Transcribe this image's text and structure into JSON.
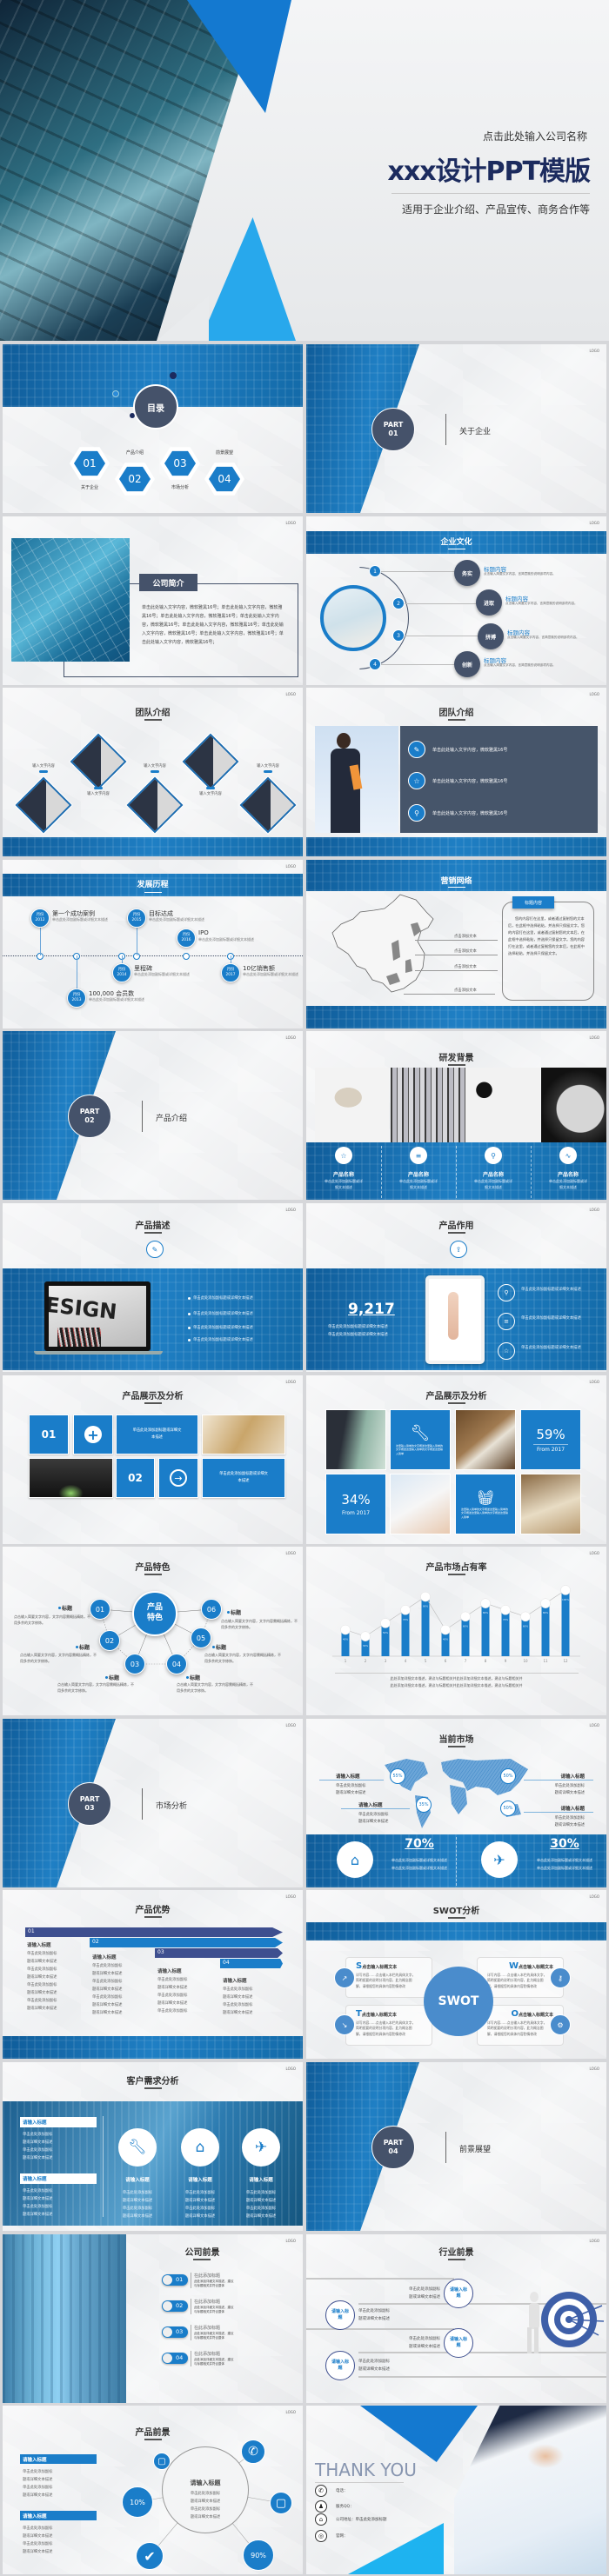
{
  "hero": {
    "company": "点击此处输入公司名称",
    "title": "xxx设计PPT模版",
    "subtitle": "适用于企业介绍、产品宣传、商务合作等"
  },
  "logo": "LOGO",
  "toc": {
    "title": "目录",
    "items": [
      {
        "num": "01",
        "label": "关于企业"
      },
      {
        "num": "02",
        "label": "产品介绍"
      },
      {
        "num": "03",
        "label": "市场分析"
      },
      {
        "num": "04",
        "label": "前景展望"
      }
    ]
  },
  "parts": [
    {
      "label": "PART",
      "num": "01",
      "name": "关于企业"
    },
    {
      "label": "PART",
      "num": "02",
      "name": "产品介绍"
    },
    {
      "label": "PART",
      "num": "03",
      "name": "市场分析"
    },
    {
      "label": "PART",
      "num": "04",
      "name": "前景展望"
    }
  ],
  "about": {
    "title": "公司简介",
    "body": "单击此处输入文字内容，微软雅黑16号；单击此处输入文字内容，微软雅黑16号；单击此处输入文字内容，微软雅黑16号；单击此处输入文字内容，微软雅黑16号；单击此处输入文字内容，微软雅黑16号；单击此处输入文字内容，微软雅黑16号；单击此处输入文字内容，微软雅黑16号；单击此处输入文字内容，微软雅黑16号；"
  },
  "culture": {
    "title": "企业文化",
    "items": [
      {
        "n": "1",
        "tag": "务实",
        "title": "标题内容",
        "desc": "点击输入简要文字内容，言简意赅的说明该项内容。"
      },
      {
        "n": "2",
        "tag": "进取",
        "title": "标题内容",
        "desc": "点击输入简要文字内容，言简意赅的说明该项内容。"
      },
      {
        "n": "3",
        "tag": "拼搏",
        "title": "标题内容",
        "desc": "点击输入简要文字内容，言简意赅的说明该项内容。"
      },
      {
        "n": "4",
        "tag": "创新",
        "title": "标题内容",
        "desc": "点击输入简要文字内容，言简意赅的说明该项内容。"
      }
    ]
  },
  "team1": {
    "title": "团队介绍",
    "captions": [
      "输入文字内容",
      "输入文字内容",
      "输入文字内容",
      "输入文字内容",
      "输入文字内容"
    ]
  },
  "team2": {
    "title": "团队介绍",
    "items": [
      {
        "icon": "edit-icon",
        "text": "单击此处输入文字内容，微软雅黑16号"
      },
      {
        "icon": "star-icon",
        "text": "单击此处输入文字内容，微软雅黑16号"
      },
      {
        "icon": "bulb-icon",
        "text": "单击此处输入文字内容，微软雅黑16号"
      }
    ]
  },
  "history": {
    "title": "发展历程",
    "month": "月份",
    "items": [
      {
        "year": "2012",
        "title": "第一个成功案例",
        "desc": "单击此处添加副标题或详细文本描述"
      },
      {
        "year": "2013",
        "title": "100,000 会员数",
        "desc": "单击此处添加副标题或详细文本描述"
      },
      {
        "year": "2014",
        "title": "里程碑",
        "desc": "单击此处添加副标题或详细文本描述"
      },
      {
        "year": "2015",
        "title": "目标达成",
        "desc": "单击此处添加副标题或详细文本描述"
      },
      {
        "year": "2016",
        "title": "IPO",
        "desc": "单击此处添加副标题或详细文本描述"
      },
      {
        "year": "2017",
        "title": "10亿销售额",
        "desc": "单击此处添加副标题或详细文本描述"
      }
    ]
  },
  "network": {
    "title": "营销网络",
    "labels": [
      "点击添加文本",
      "点击添加文本",
      "点击添加文本",
      "点击添加文本"
    ],
    "box_title": "标题内容",
    "box_body": "您的内容打在这里，或者通过复制您的文本后，在此框中选择粘贴，并选择只保留文字。您的内容打在这里，或者通过复制您的文本后，在此框中选择粘贴，并选择只保留文字。您的内容打在这里，或者通过复制您的文本后，在此框中选择粘贴，并选择只保留文字。"
  },
  "rd": {
    "title": "研发背景",
    "items": [
      {
        "icon": "star-icon",
        "name": "产品名称",
        "desc": "单击此处添加副标题或详细文本描述"
      },
      {
        "icon": "list-icon",
        "name": "产品名称",
        "desc": "单击此处添加副标题或详细文本描述"
      },
      {
        "icon": "bulb-icon",
        "name": "产品名称",
        "desc": "单击此处添加副标题或详细文本描述"
      },
      {
        "icon": "chart-icon",
        "name": "产品名称",
        "desc": "单击此处添加副标题或详细文本描述"
      }
    ]
  },
  "desc": {
    "title": "产品描述",
    "screen_word": "ESIGN",
    "bullets": [
      "单击此处添加副标题或详细文本描述",
      "单击此处添加副标题或详细文本描述",
      "单击此处添加副标题或详细文本描述",
      "单击此处添加副标题或详细文本描述"
    ]
  },
  "effect": {
    "title": "产品作用",
    "number": "9,217",
    "lines": [
      "单击此处添加副标题或详细文本描述",
      "单击此处添加副标题或详细文本描述"
    ],
    "items": [
      {
        "icon": "bulb-icon",
        "text": "单击此处添加副标题或详细文本描述"
      },
      {
        "icon": "list-icon",
        "text": "单击此处添加副标题或详细文本描述"
      },
      {
        "icon": "star-icon",
        "text": "单击此处添加副标题或详细文本描述"
      }
    ]
  },
  "show1": {
    "title": "产品展示及分析",
    "n1": "01",
    "n2": "02",
    "text": "单击此处添加副标题或详细文本描述"
  },
  "show2": {
    "title": "产品展示及分析",
    "stat_a": {
      "value": "59%",
      "from": "From 2017"
    },
    "stat_b": {
      "value": "34%",
      "from": "From 2017"
    },
    "tile_text": "这里输入简单的文字概述这里输入简单的文字概述这里输入简单的文字概述这里输入简单"
  },
  "features": {
    "title": "产品特色",
    "center": "产品特色",
    "items": [
      {
        "n": "01",
        "title": "标题",
        "desc": "点击输入简要文字内容，文字内容需概括精炼，不用多余的文字修饰。"
      },
      {
        "n": "02",
        "title": "标题",
        "desc": "点击输入简要文字内容，文字内容需概括精炼，不用多余的文字修饰。"
      },
      {
        "n": "03",
        "title": "标题",
        "desc": "点击输入简要文字内容，文字内容需概括精炼，不用多余的文字修饰。"
      },
      {
        "n": "04",
        "title": "标题",
        "desc": "点击输入简要文字内容，文字内容需概括精炼，不用多余的文字修饰。"
      },
      {
        "n": "05",
        "title": "标题",
        "desc": "点击输入简要文字内容，文字内容需概括精炼，不用多余的文字修饰。"
      },
      {
        "n": "06",
        "title": "标题",
        "desc": "点击输入简要文字内容，文字内容需概括精炼，不用多余的文字修饰。"
      }
    ]
  },
  "chart_data": {
    "type": "bar",
    "title": "产品市场占有率",
    "categories": [
      "1",
      "2",
      "3",
      "4",
      "5",
      "6",
      "7",
      "8",
      "9",
      "10",
      "11",
      "12"
    ],
    "values": [
      40,
      30,
      50,
      70,
      90,
      40,
      60,
      80,
      70,
      60,
      80,
      100
    ],
    "value_labels": [
      "40%",
      "30%",
      "50%",
      "70%",
      "90%",
      "40%",
      "60%",
      "80%",
      "70%",
      "60%",
      "80%",
      "100%"
    ],
    "ylim": [
      0,
      100
    ],
    "grid": false,
    "bar_color": "#1a7dc9",
    "caption": [
      "此处添加详细文本描述，建议与标题相关并此处添加详细文本描述，建议与标题相关并",
      "此处添加详细文本描述，建议与标题相关并此处添加详细文本描述，建议与标题相关并"
    ]
  },
  "market": {
    "title": "当前市场",
    "regions": [
      {
        "pct": "55%",
        "title": "请输入标题",
        "desc": [
          "单击此处添加副标",
          "题或详细文本描述"
        ]
      },
      {
        "pct": "35%",
        "title": "请输入标题",
        "desc": [
          "单击此处添加副标",
          "题或详细文本描述"
        ]
      },
      {
        "pct": "50%",
        "title": "请输入标题",
        "desc": [
          "单击此处添加副标",
          "题或详细文本描述"
        ]
      },
      {
        "pct": "50%",
        "title": "请输入标题",
        "desc": [
          "单击此处添加副标",
          "题或详细文本描述"
        ]
      }
    ],
    "stats": [
      {
        "value": "70%",
        "icon": "house-icon",
        "desc": [
          "单击此处添加副标题或详细文本描述",
          "单击此处添加副标题或详细文本描述"
        ]
      },
      {
        "value": "30%",
        "icon": "paper-plane-icon",
        "desc": [
          "单击此处添加副标题或详细文本描述",
          "单击此处添加副标题或详细文本描述"
        ]
      }
    ]
  },
  "advantage": {
    "title": "产品优势",
    "items": [
      {
        "n": "01",
        "title": "请输入标题",
        "lines": [
          "单击此处添加副标",
          "题或详细文本描述",
          "单击此处添加副标",
          "题或详细文本描述",
          "单击此处添加副标",
          "题或详细文本描述",
          "单击此处添加副标",
          "题或详细文本描述"
        ]
      },
      {
        "n": "02",
        "title": "请输入标题",
        "lines": [
          "单击此处添加副标",
          "题或详细文本描述",
          "单击此处添加副标",
          "题或详细文本描述",
          "单击此处添加副标",
          "题或详细文本描述",
          "题或详细文本描述"
        ]
      },
      {
        "n": "03",
        "title": "请输入标题",
        "lines": [
          "单击此处添加副标",
          "题或详细文本描述",
          "单击此处添加副标",
          "题或详细文本描述",
          "单击此处添加副标"
        ]
      },
      {
        "n": "04",
        "title": "请输入标题",
        "lines": [
          "单击此处添加副标",
          "题或详细文本描述",
          "单击此处添加副标",
          "题或详细文本描述"
        ]
      }
    ]
  },
  "swot": {
    "title": "SWOT分析",
    "center": "SWOT",
    "items": [
      {
        "letter": "S",
        "title": "点击输入标题文本",
        "desc": "详写内容……点击输入本栏的具体文字，简明扼要的说明分项内容，此为概念图解，请根据您的具体内容酌情修改"
      },
      {
        "letter": "W",
        "title": "点击输入标题文本",
        "desc": "详写内容……点击输入本栏的具体文字，简明扼要的说明分项内容，此为概念图解，请根据您的具体内容酌情修改"
      },
      {
        "letter": "T",
        "title": "点击输入标题文本",
        "desc": "详写内容……点击输入本栏的具体文字，简明扼要的说明分项内容，此为概念图解，请根据您的具体内容酌情修改"
      },
      {
        "letter": "O",
        "title": "点击输入标题文本",
        "desc": "详写内容……点击输入本栏的具体文字，简明扼要的说明分项内容，此为概念图解，请根据您的具体内容酌情修改"
      }
    ]
  },
  "needs": {
    "title": "客户需求分析",
    "side": [
      {
        "title": "请输入标题",
        "lines": [
          "单击此处添加副标",
          "题或详细文本描述",
          "单击此处添加副标",
          "题或详细文本描述"
        ]
      },
      {
        "title": "请输入标题",
        "lines": [
          "单击此处添加副标",
          "题或详细文本描述",
          "单击此处添加副标",
          "题或详细文本描述"
        ]
      }
    ],
    "items": [
      {
        "icon": "wrench-icon",
        "title": "请输入标题",
        "lines": [
          "单击此处添加副标",
          "题或详细文本描述",
          "单击此处添加副标",
          "题或详细文本描述"
        ]
      },
      {
        "icon": "house-icon",
        "title": "请输入标题",
        "lines": [
          "单击此处添加副标",
          "题或详细文本描述",
          "单击此处添加副标",
          "题或详细文本描述"
        ]
      },
      {
        "icon": "paper-plane-icon",
        "title": "请输入标题",
        "lines": [
          "单击此处添加副标",
          "题或详细文本描述",
          "单击此处添加副标",
          "题或详细文本描述"
        ]
      }
    ]
  },
  "company_outlook": {
    "title": "公司前景",
    "items": [
      {
        "n": "01",
        "title": "在此添加标题",
        "desc": [
          "此处添加详细文本描述，建议",
          "与标题相关并符合整体"
        ]
      },
      {
        "n": "02",
        "title": "在此添加标题",
        "desc": [
          "此处添加详细文本描述，建议",
          "与标题相关并符合整体"
        ]
      },
      {
        "n": "03",
        "title": "在此添加标题",
        "desc": [
          "此处添加详细文本描述，建议",
          "与标题相关并符合整体"
        ]
      },
      {
        "n": "04",
        "title": "在此添加标题",
        "desc": [
          "此处添加详细文本描述，建议",
          "与标题相关并符合整体"
        ]
      }
    ]
  },
  "industry": {
    "title": "行业前景",
    "items": [
      {
        "tag": "请输入标题",
        "desc": [
          "单击此处添加副标",
          "题或详细文本描述"
        ]
      },
      {
        "tag": "请输入标题",
        "desc": [
          "单击此处添加副标",
          "题或详细文本描述"
        ]
      },
      {
        "tag": "请输入标题",
        "desc": [
          "单击此处添加副标",
          "题或详细文本描述"
        ]
      },
      {
        "tag": "请输入标题",
        "desc": [
          "单击此处添加副标",
          "题或详细文本描述"
        ]
      }
    ]
  },
  "product_outlook": {
    "title": "产品前景",
    "side": [
      {
        "title": "请输入标题",
        "lines": [
          "单击此处添加副标",
          "题或详细文本描述",
          "单击此处添加副标",
          "题或详细文本描述"
        ]
      },
      {
        "title": "请输入标题",
        "lines": [
          "单击此处添加副标",
          "题或详细文本描述",
          "单击此处添加副标",
          "题或详细文本描述"
        ]
      }
    ],
    "center_title": "请输入标题",
    "center_lines": [
      "单击此处添加副标",
      "题或详细文本描述",
      "单击此处添加副标",
      "题或详细文本描述"
    ],
    "pct_a": "10%",
    "pct_b": "90%"
  },
  "thanks": {
    "title": "THANK YOU",
    "contacts": [
      {
        "icon": "phone-icon",
        "label": "电话：",
        "value": ""
      },
      {
        "icon": "qq-icon",
        "label": "服务QQ：",
        "value": ""
      },
      {
        "icon": "address-icon",
        "label": "公司地址：",
        "value": "单击此处添加标题"
      },
      {
        "icon": "web-icon",
        "label": "官网：",
        "value": ""
      }
    ]
  },
  "colors": {
    "primary": "#1a7dc9",
    "dark": "#45526a",
    "navy": "#1c2b5e"
  }
}
